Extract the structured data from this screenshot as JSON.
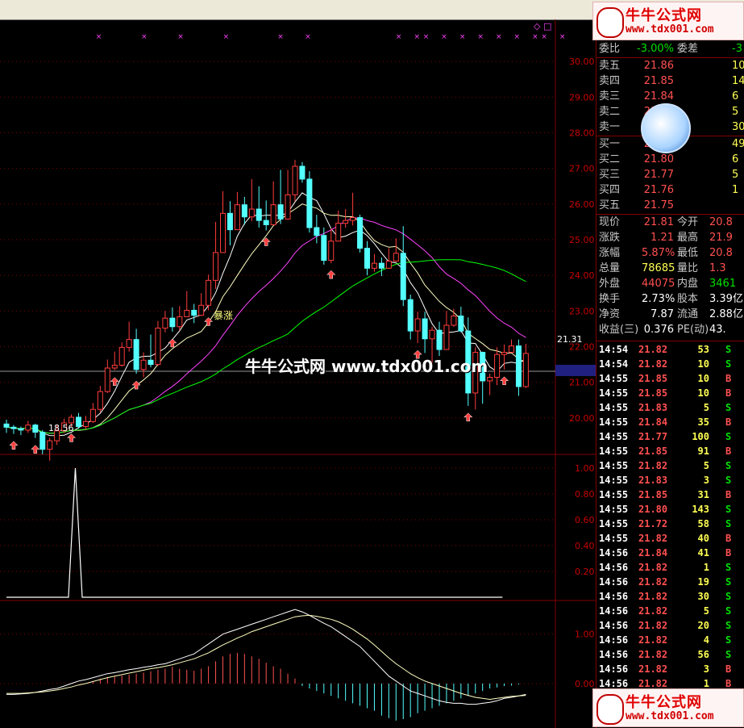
{
  "chart_data": {
    "type": "candlestick",
    "price_axis": {
      "ticks": [
        "30.00",
        "29.00",
        "28.00",
        "27.00",
        "26.00",
        "25.00",
        "24.00",
        "23.00",
        "22.00",
        "21.00",
        "20.00"
      ],
      "min": 19.0,
      "max": 31.0,
      "marker": "21.31"
    },
    "annotations": {
      "low_label": "18.56",
      "signal_label": "暴涨"
    },
    "candles": [
      [
        19.83,
        19.74,
        19.95,
        19.58
      ],
      [
        19.74,
        19.7,
        19.8,
        19.55
      ],
      [
        19.7,
        19.66,
        19.76,
        19.52
      ],
      [
        19.66,
        19.8,
        19.92,
        19.58
      ],
      [
        19.8,
        19.6,
        19.84,
        19.44
      ],
      [
        19.6,
        19.12,
        19.66,
        18.98
      ],
      [
        19.12,
        19.36,
        19.44,
        18.8
      ],
      [
        19.36,
        19.64,
        19.8,
        19.24
      ],
      [
        19.64,
        19.86,
        19.98,
        19.58
      ],
      [
        19.86,
        20.02,
        20.1,
        19.76
      ],
      [
        20.02,
        19.76,
        20.14,
        19.7
      ],
      [
        19.76,
        19.9,
        20.06,
        19.68
      ],
      [
        19.9,
        20.24,
        20.42,
        19.86
      ],
      [
        20.24,
        20.74,
        20.9,
        20.16
      ],
      [
        20.74,
        21.4,
        21.64,
        20.7
      ],
      [
        21.4,
        21.48,
        21.86,
        21.34
      ],
      [
        21.48,
        21.98,
        22.12,
        21.44
      ],
      [
        21.98,
        22.2,
        22.7,
        21.86
      ],
      [
        22.2,
        21.36,
        22.5,
        21.24
      ],
      [
        21.36,
        21.62,
        21.84,
        21.14
      ],
      [
        21.62,
        21.5,
        22.34,
        21.42
      ],
      [
        21.5,
        22.52,
        22.72,
        21.46
      ],
      [
        22.52,
        22.8,
        23.0,
        22.4
      ],
      [
        22.8,
        22.56,
        23.1,
        22.42
      ],
      [
        22.56,
        22.84,
        23.14,
        22.46
      ],
      [
        22.84,
        23.02,
        23.56,
        22.84
      ],
      [
        23.02,
        22.88,
        23.2,
        22.66
      ],
      [
        22.88,
        23.16,
        23.5,
        22.86
      ],
      [
        23.16,
        23.86,
        24.02,
        23.02
      ],
      [
        23.86,
        24.64,
        25.5,
        23.62
      ],
      [
        24.64,
        25.74,
        26.36,
        24.64
      ],
      [
        25.74,
        25.28,
        26.08,
        24.84
      ],
      [
        25.28,
        25.98,
        26.34,
        25.28
      ],
      [
        25.98,
        25.64,
        26.2,
        25.42
      ],
      [
        25.64,
        25.86,
        26.7,
        25.52
      ],
      [
        25.86,
        25.54,
        26.5,
        25.34
      ],
      [
        25.54,
        25.42,
        26.1,
        25.26
      ],
      [
        25.42,
        25.98,
        26.64,
        25.4
      ],
      [
        25.98,
        25.58,
        26.96,
        25.44
      ],
      [
        25.58,
        26.26,
        26.96,
        25.56
      ],
      [
        26.26,
        27.06,
        27.24,
        26.08
      ],
      [
        27.06,
        26.7,
        27.18,
        26.6
      ],
      [
        26.7,
        25.34,
        26.92,
        25.2
      ],
      [
        25.34,
        25.12,
        25.7,
        24.9
      ],
      [
        25.12,
        24.42,
        25.34,
        24.3
      ],
      [
        24.42,
        24.96,
        25.32,
        24.34
      ],
      [
        24.96,
        25.46,
        25.82,
        24.96
      ],
      [
        25.46,
        25.54,
        25.86,
        25.34
      ],
      [
        25.54,
        25.62,
        26.32,
        25.4
      ],
      [
        25.62,
        24.76,
        25.7,
        24.64
      ],
      [
        24.76,
        24.2,
        24.96,
        24.0
      ],
      [
        24.2,
        24.34,
        24.6,
        24.1
      ],
      [
        24.34,
        24.2,
        24.5,
        23.98
      ],
      [
        24.2,
        24.4,
        24.76,
        24.18
      ],
      [
        24.4,
        24.62,
        25.04,
        24.38
      ],
      [
        24.62,
        23.32,
        25.38,
        23.14
      ],
      [
        23.32,
        22.44,
        23.46,
        22.2
      ],
      [
        22.44,
        22.78,
        22.98,
        22.1
      ],
      [
        22.78,
        22.22,
        22.98,
        21.82
      ],
      [
        22.22,
        22.46,
        22.56,
        21.4
      ],
      [
        22.46,
        21.92,
        22.7,
        21.74
      ],
      [
        21.92,
        22.6,
        23.0,
        22.5
      ],
      [
        22.6,
        22.86,
        23.06,
        22.56
      ],
      [
        22.86,
        22.44,
        23.12,
        22.4
      ],
      [
        22.44,
        20.7,
        22.82,
        20.34
      ],
      [
        20.7,
        21.84,
        21.98,
        20.24
      ],
      [
        21.84,
        21.04,
        21.86,
        20.4
      ],
      [
        21.04,
        21.14,
        21.24,
        20.64
      ],
      [
        21.14,
        21.78,
        21.98,
        20.92
      ],
      [
        21.78,
        21.84,
        22.06,
        21.36
      ],
      [
        21.84,
        22.02,
        22.2,
        21.86
      ],
      [
        22.02,
        20.88,
        22.2,
        20.62
      ],
      [
        20.88,
        21.81,
        22.08,
        20.84
      ]
    ],
    "up_arrows_at": [
      1,
      4,
      9,
      15,
      18,
      23,
      28,
      36,
      45,
      57,
      64,
      69
    ],
    "top_markers_at": [
      10,
      15,
      19,
      24,
      30,
      33,
      43,
      45,
      46,
      48,
      50,
      52,
      54,
      56,
      58,
      59,
      61
    ],
    "oscillator_axis": {
      "ticks": [
        "1.00",
        "0.80",
        "0.60",
        "0.40",
        "0.20"
      ],
      "min": 0,
      "max": 1.05
    },
    "oscillator": [
      0,
      0,
      0,
      0,
      0,
      0,
      0,
      0,
      0,
      0,
      1,
      0,
      0,
      0,
      0,
      0,
      0,
      0,
      0,
      0,
      0,
      0,
      0,
      0,
      0,
      0,
      0,
      0,
      0,
      0,
      0,
      0,
      0,
      0,
      0,
      0,
      0,
      0,
      0,
      0,
      0,
      0,
      0,
      0,
      0,
      0,
      0,
      0,
      0,
      0,
      0,
      0,
      0,
      0,
      0,
      0,
      0,
      0,
      0,
      0,
      0,
      0,
      0,
      0,
      0,
      0,
      0,
      0,
      0,
      0,
      0,
      0,
      0
    ],
    "macd_axis": {
      "ticks": [
        "1.00",
        "0.00"
      ],
      "min": -0.9,
      "max": 1.55
    },
    "macd_hist": [
      0,
      0,
      0,
      0,
      0,
      0,
      0,
      0,
      0,
      0,
      0,
      0,
      0.05,
      0.1,
      0.12,
      0.14,
      0.16,
      0.18,
      0.2,
      0.22,
      0.25,
      0.28,
      0.3,
      0.34,
      0.3,
      0.28,
      0.26,
      0.3,
      0.35,
      0.45,
      0.55,
      0.6,
      0.62,
      0.6,
      0.55,
      0.5,
      0.42,
      0.35,
      0.3,
      0.2,
      0.1,
      -0.05,
      -0.1,
      -0.15,
      -0.2,
      -0.25,
      -0.3,
      -0.35,
      -0.4,
      -0.45,
      -0.5,
      -0.55,
      -0.65,
      -0.7,
      -0.75,
      -0.72,
      -0.68,
      -0.6,
      -0.55,
      -0.5,
      -0.45,
      -0.4,
      -0.35,
      -0.3,
      -0.25,
      -0.2,
      -0.15,
      -0.1,
      -0.08,
      -0.05,
      -0.04,
      -0.02,
      0
    ],
    "macd_dif": [
      -0.22,
      -0.22,
      -0.21,
      -0.2,
      -0.18,
      -0.15,
      -0.12,
      -0.1,
      -0.05,
      0,
      0.05,
      0.08,
      0.12,
      0.16,
      0.2,
      0.22,
      0.25,
      0.28,
      0.3,
      0.33,
      0.35,
      0.38,
      0.4,
      0.45,
      0.5,
      0.55,
      0.6,
      0.7,
      0.8,
      0.9,
      1.0,
      1.05,
      1.1,
      1.15,
      1.2,
      1.25,
      1.3,
      1.35,
      1.4,
      1.45,
      1.5,
      1.45,
      1.38,
      1.3,
      1.22,
      1.15,
      1.05,
      0.95,
      0.85,
      0.75,
      0.6,
      0.45,
      0.3,
      0.15,
      0.05,
      -0.05,
      -0.15,
      -0.2,
      -0.25,
      -0.3,
      -0.35,
      -0.38,
      -0.4,
      -0.4,
      -0.42,
      -0.42,
      -0.4,
      -0.38,
      -0.35,
      -0.3,
      -0.28,
      -0.25,
      -0.22
    ],
    "macd_dea": [
      -0.2,
      -0.2,
      -0.2,
      -0.19,
      -0.18,
      -0.17,
      -0.15,
      -0.13,
      -0.1,
      -0.07,
      -0.03,
      0,
      0.04,
      0.08,
      0.12,
      0.15,
      0.18,
      0.21,
      0.24,
      0.27,
      0.3,
      0.32,
      0.35,
      0.38,
      0.42,
      0.46,
      0.5,
      0.56,
      0.62,
      0.7,
      0.78,
      0.85,
      0.92,
      0.98,
      1.05,
      1.1,
      1.15,
      1.2,
      1.25,
      1.3,
      1.35,
      1.37,
      1.38,
      1.36,
      1.33,
      1.3,
      1.25,
      1.18,
      1.1,
      1.0,
      0.9,
      0.78,
      0.65,
      0.52,
      0.4,
      0.3,
      0.2,
      0.12,
      0.05,
      0,
      -0.05,
      -0.1,
      -0.15,
      -0.2,
      -0.24,
      -0.28,
      -0.3,
      -0.32,
      -0.3,
      -0.28,
      -0.26,
      -0.25,
      -0.24
    ]
  },
  "topbar": {
    "marker": "◇ □"
  },
  "order_book": {
    "header": {
      "label1": "委比",
      "value1": "-3.00%",
      "label2": "委差",
      "value2": "-3"
    },
    "asks": [
      {
        "label": "卖五",
        "price": "21.86",
        "vol": "10"
      },
      {
        "label": "卖四",
        "price": "21.85",
        "vol": "14"
      },
      {
        "label": "卖三",
        "price": "21.84",
        "vol": "6"
      },
      {
        "label": "卖二",
        "price": "21.83",
        "vol": "5"
      },
      {
        "label": "卖一",
        "price": "21.82",
        "vol": "30"
      }
    ],
    "bids": [
      {
        "label": "买一",
        "price": "21.81",
        "vol": "49"
      },
      {
        "label": "买二",
        "price": "21.80",
        "vol": "6"
      },
      {
        "label": "买三",
        "price": "21.77",
        "vol": "5"
      },
      {
        "label": "买四",
        "price": "21.76",
        "vol": "1"
      },
      {
        "label": "买五",
        "price": "21.75",
        "vol": ""
      }
    ]
  },
  "stats": [
    {
      "l1": "现价",
      "v1": "21.81",
      "c1": "red",
      "l2": "今开",
      "v2": "20.8",
      "c2": "red"
    },
    {
      "l1": "涨跌",
      "v1": "1.21",
      "c1": "red",
      "l2": "最高",
      "v2": "21.9",
      "c2": "red"
    },
    {
      "l1": "涨幅",
      "v1": "5.87%",
      "c1": "red",
      "l2": "最低",
      "v2": "20.8",
      "c2": "red"
    },
    {
      "l1": "总量",
      "v1": "78685",
      "c1": "yel",
      "l2": "量比",
      "v2": "1.3",
      "c2": "red"
    },
    {
      "l1": "外盘",
      "v1": "44075",
      "c1": "red",
      "l2": "内盘",
      "v2": "3461",
      "c2": "grn"
    },
    {
      "l1": "换手",
      "v1": "2.73%",
      "c1": "wht",
      "l2": "股本",
      "v2": "3.39亿",
      "c2": "wht"
    },
    {
      "l1": "净资",
      "v1": "7.87",
      "c1": "wht",
      "l2": "流通",
      "v2": "2.88亿",
      "c2": "wht"
    },
    {
      "l1": "收益(三)",
      "v1": "0.376",
      "c1": "wht",
      "l2": "PE(动)",
      "v2": "43.",
      "c2": "wht"
    }
  ],
  "ticks": [
    {
      "t": "14:54",
      "p": "21.82",
      "v": "53",
      "f": "S"
    },
    {
      "t": "14:54",
      "p": "21.82",
      "v": "10",
      "f": "S"
    },
    {
      "t": "14:55",
      "p": "21.85",
      "v": "10",
      "f": "B"
    },
    {
      "t": "14:55",
      "p": "21.85",
      "v": "10",
      "f": "B"
    },
    {
      "t": "14:55",
      "p": "21.83",
      "v": "5",
      "f": "S"
    },
    {
      "t": "14:55",
      "p": "21.84",
      "v": "35",
      "f": "B"
    },
    {
      "t": "14:55",
      "p": "21.77",
      "v": "100",
      "f": "S"
    },
    {
      "t": "14:55",
      "p": "21.85",
      "v": "91",
      "f": "B"
    },
    {
      "t": "14:55",
      "p": "21.82",
      "v": "5",
      "f": "S"
    },
    {
      "t": "14:55",
      "p": "21.83",
      "v": "3",
      "f": "S"
    },
    {
      "t": "14:55",
      "p": "21.85",
      "v": "31",
      "f": "B"
    },
    {
      "t": "14:55",
      "p": "21.80",
      "v": "143",
      "f": "S"
    },
    {
      "t": "14:55",
      "p": "21.72",
      "v": "58",
      "f": "S"
    },
    {
      "t": "14:55",
      "p": "21.82",
      "v": "40",
      "f": "B"
    },
    {
      "t": "14:56",
      "p": "21.84",
      "v": "41",
      "f": "B"
    },
    {
      "t": "14:56",
      "p": "21.82",
      "v": "1",
      "f": "S"
    },
    {
      "t": "14:56",
      "p": "21.82",
      "v": "19",
      "f": "S"
    },
    {
      "t": "14:56",
      "p": "21.82",
      "v": "30",
      "f": "S"
    },
    {
      "t": "14:56",
      "p": "21.82",
      "v": "5",
      "f": "S"
    },
    {
      "t": "14:56",
      "p": "21.82",
      "v": "20",
      "f": "S"
    },
    {
      "t": "14:56",
      "p": "21.82",
      "v": "4",
      "f": "S"
    },
    {
      "t": "14:56",
      "p": "21.82",
      "v": "56",
      "f": "S"
    },
    {
      "t": "14:56",
      "p": "21.82",
      "v": "3",
      "f": "B"
    },
    {
      "t": "14:56",
      "p": "21.82",
      "v": "1",
      "f": "B"
    }
  ],
  "watermark": {
    "center": "牛牛公式网 www.tdx001.com",
    "logo_cn": "牛牛公式网",
    "logo_url": "www.tdx001.com"
  },
  "colors": {
    "up": "#ff3c3c",
    "down": "#54ffff",
    "ma5": "#ffffff",
    "ma10": "#ffff00",
    "ma20": "#ff44ff",
    "ma60": "#00ff00",
    "grid": "#800000"
  }
}
